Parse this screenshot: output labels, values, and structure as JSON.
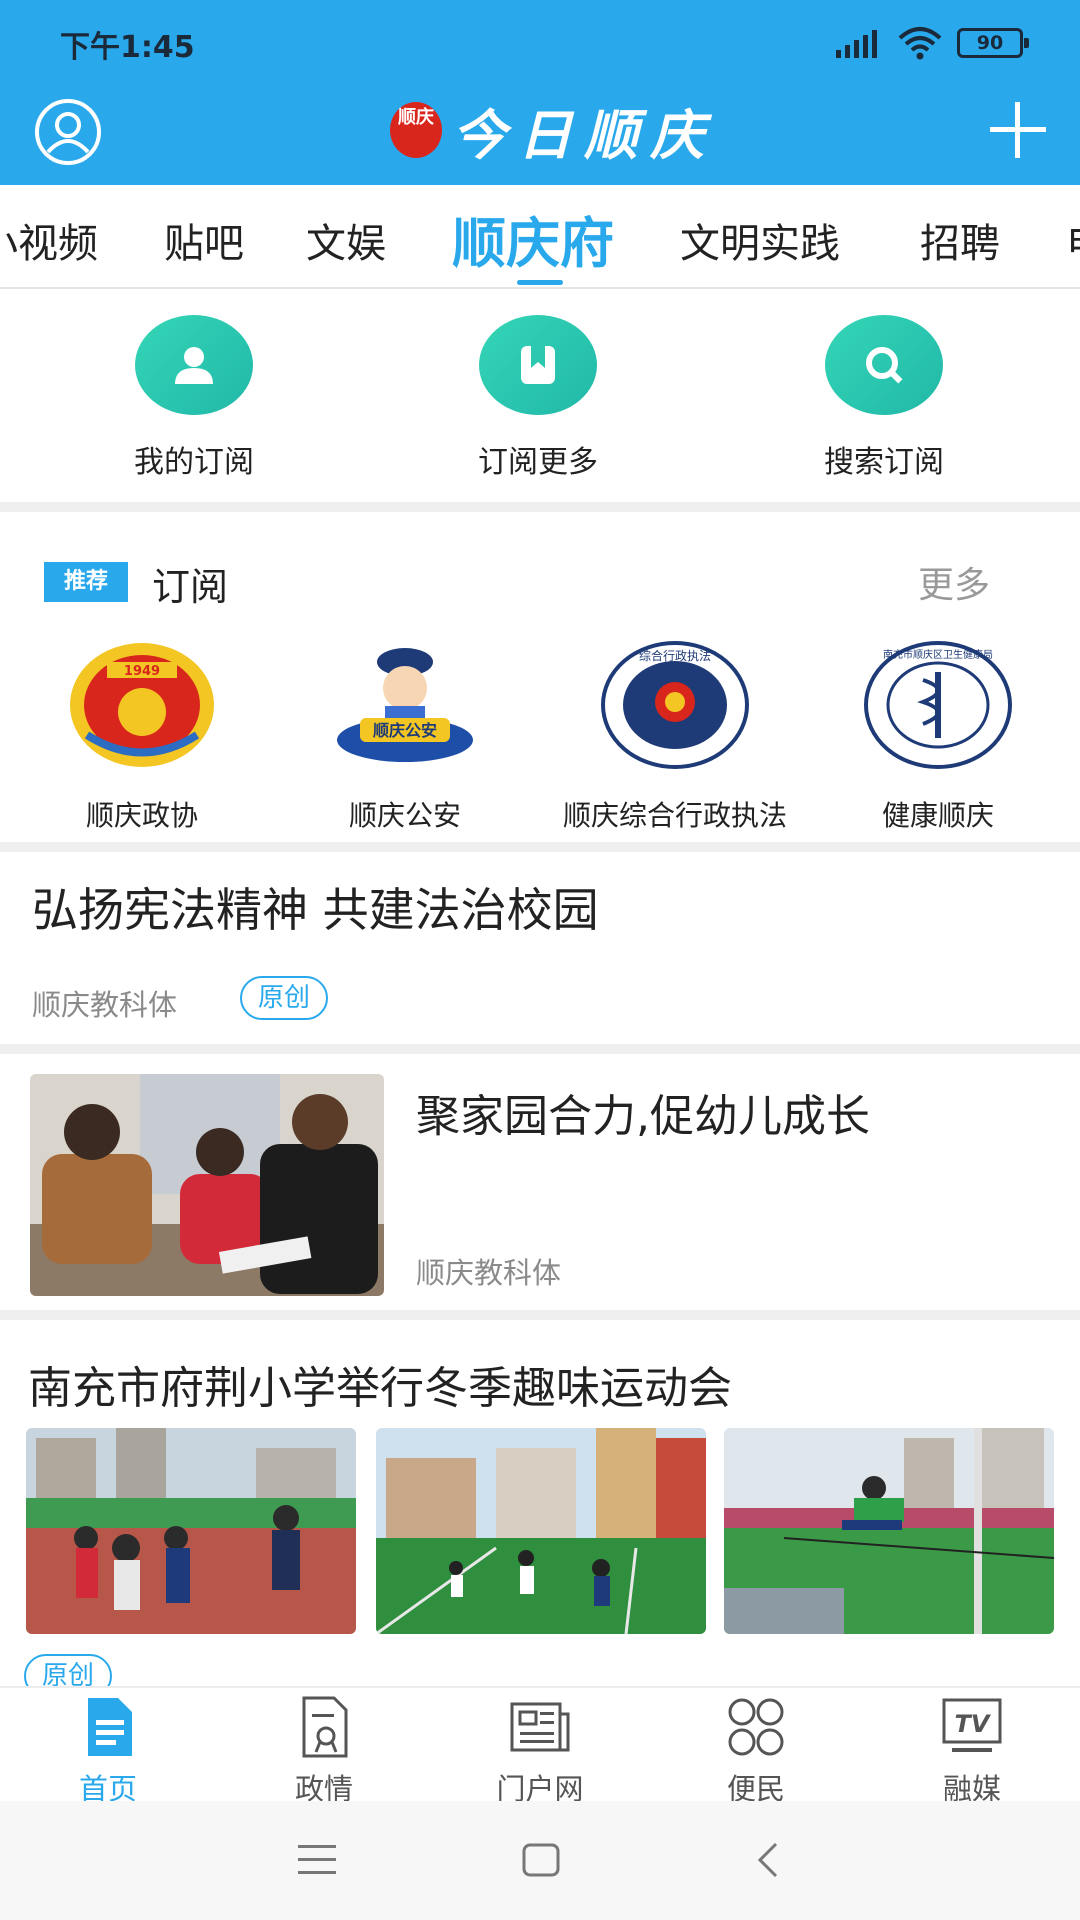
{
  "status_bar": {
    "time": "下午1:45",
    "battery": "90"
  },
  "header": {
    "brand_seal": "顺庆",
    "brand_title": "今日顺庆",
    "user_icon": "user-circle-icon",
    "add_icon": "plus-icon"
  },
  "tabs": [
    {
      "label": "小视频"
    },
    {
      "label": "贴吧"
    },
    {
      "label": "文娱"
    },
    {
      "label": "顺庆府",
      "active": true
    },
    {
      "label": "文明实践"
    },
    {
      "label": "招聘"
    },
    {
      "label": "电"
    }
  ],
  "quick_actions": [
    {
      "label": "我的订阅",
      "icon": "person-icon"
    },
    {
      "label": "订阅更多",
      "icon": "bookmark-icon"
    },
    {
      "label": "搜索订阅",
      "icon": "search-icon"
    }
  ],
  "recommend": {
    "badge": "推荐",
    "title": "订阅",
    "more": "更多",
    "items": [
      {
        "label": "顺庆政协",
        "logo_text": "1949"
      },
      {
        "label": "顺庆公安",
        "logo_text": "顺庆公安"
      },
      {
        "label": "顺庆综合行政执法",
        "logo_text": "综合行政执法"
      },
      {
        "label": "健康顺庆",
        "logo_text": "南充市顺庆区卫生健康局"
      }
    ]
  },
  "articles": [
    {
      "title": "弘扬宪法精神 共建法治校园",
      "source": "顺庆教科体",
      "tag": "原创"
    },
    {
      "title": "聚家园合力,促幼儿成长",
      "source": "顺庆教科体"
    },
    {
      "title": "南充市府荆小学举行冬季趣味运动会",
      "tag": "原创"
    }
  ],
  "bottom_nav": [
    {
      "label": "首页",
      "icon": "home-doc-icon",
      "active": true
    },
    {
      "label": "政情",
      "icon": "gov-doc-icon"
    },
    {
      "label": "门户网",
      "icon": "newspaper-icon"
    },
    {
      "label": "便民",
      "icon": "grid-icon"
    },
    {
      "label": "融媒",
      "icon": "tv-icon",
      "tv_text": "TV"
    }
  ],
  "colors": {
    "primary": "#29a9ec",
    "accent_green": "#2cc9b0"
  }
}
